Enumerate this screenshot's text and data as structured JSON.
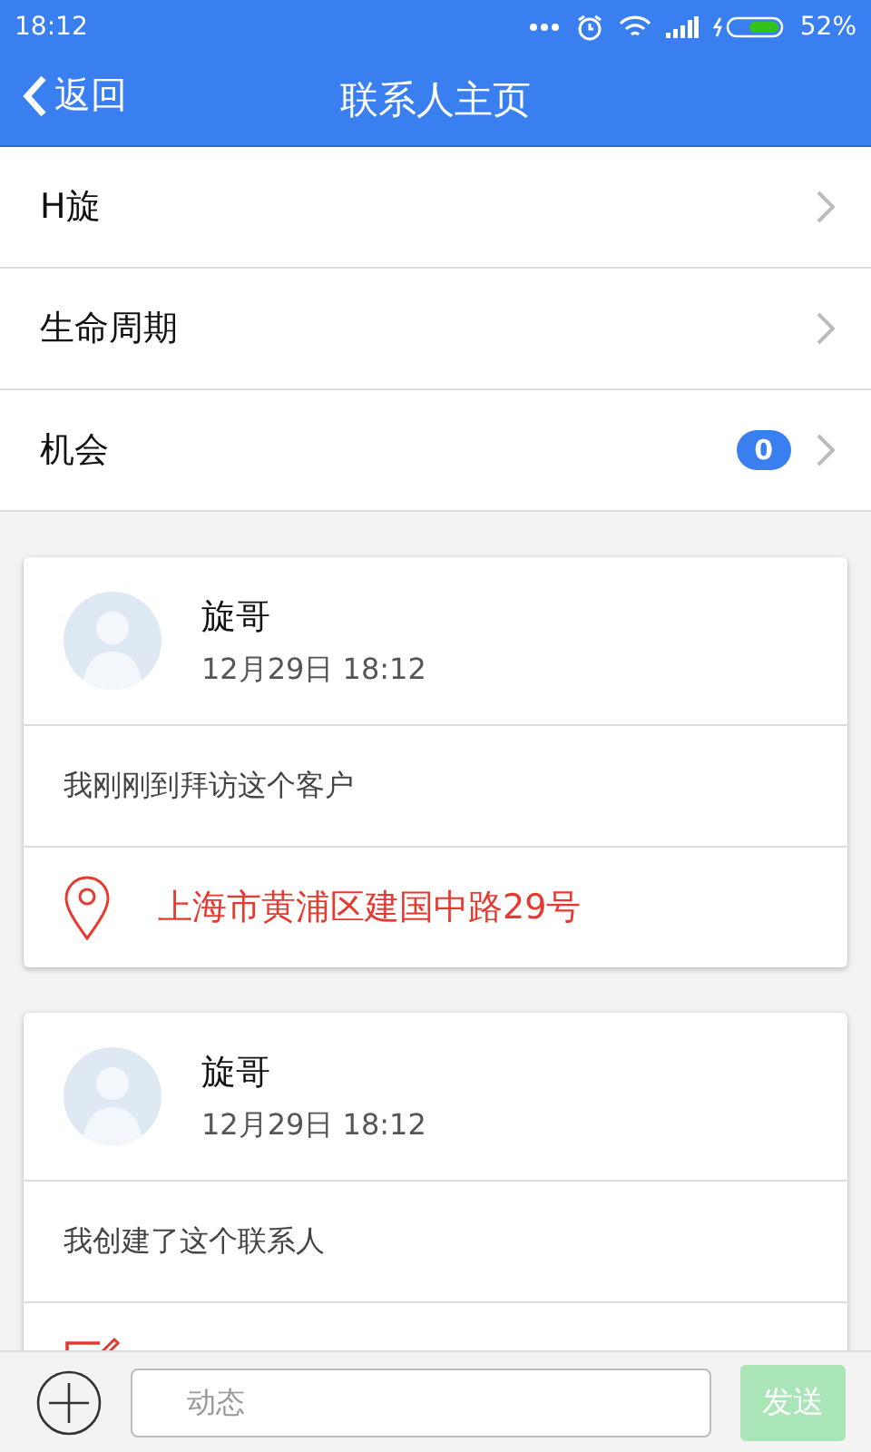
{
  "status_bar": {
    "time": "18:12",
    "battery": "52%"
  },
  "header": {
    "back": "返回",
    "title": "联系人主页"
  },
  "menu": [
    {
      "label": "H旋"
    },
    {
      "label": "生命周期"
    },
    {
      "label": "机会",
      "badge": "0"
    }
  ],
  "feed": [
    {
      "author": "旋哥",
      "time": "12月29日 18:12",
      "text": "我刚刚到拜访这个客户",
      "footer": {
        "kind": "location",
        "text": "上海市黄浦区建国中路29号"
      }
    },
    {
      "author": "旋哥",
      "time": "12月29日 18:12",
      "text": "我创建了这个联系人",
      "footer": {
        "kind": "report"
      }
    }
  ],
  "composer": {
    "placeholder": "动态",
    "send": "发送",
    "send_disabled": true
  }
}
